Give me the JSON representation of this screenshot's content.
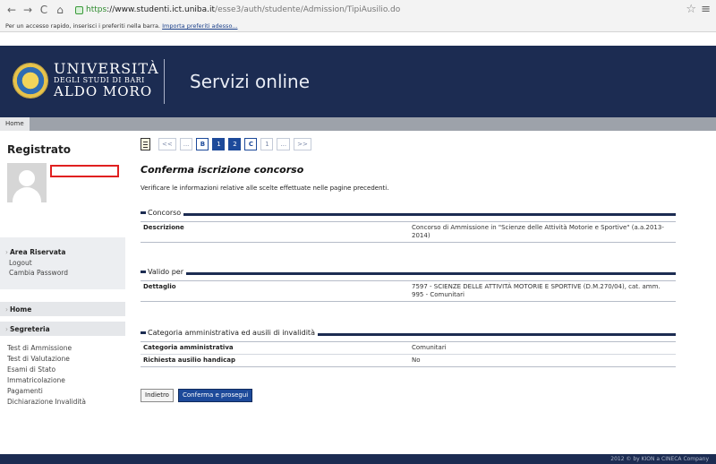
{
  "browser": {
    "url_https": "https",
    "url_host": "://www.studenti.ict.uniba.it",
    "url_path": "/esse3/auth/studente/Admission/TipiAusilio.do",
    "bookmarks_text": "Per un accesso rapido, inserisci i preferiti nella barra.",
    "bookmarks_link": "Importa preferiti adesso..."
  },
  "header": {
    "uni_line1": "UNIVERSITÀ",
    "uni_line2": "DEGLI STUDI DI BARI",
    "uni_line3": "ALDO MORO",
    "services_title": "Servizi online",
    "breadcrumb_home": "Home",
    "colors": {
      "header_bg": "#1c2c52",
      "accent": "#1d4a9a"
    }
  },
  "sidebar": {
    "title": "Registrato",
    "area_riservata": "Area Riservata",
    "logout": "Logout",
    "cambia_password": "Cambia Password",
    "home": "Home",
    "segreteria": "Segreteria",
    "links": [
      "Test di Ammissione",
      "Test di Valutazione",
      "Esami di Stato",
      "Immatricolazione",
      "Pagamenti",
      "Dichiarazione Invalidità"
    ]
  },
  "pager": {
    "prev": "<<",
    "ellipsis1": "...",
    "b": "B",
    "p1": "1",
    "p2": "2",
    "c": "C",
    "p1b": "1",
    "ellipsis2": "...",
    "next": ">>"
  },
  "main": {
    "title": "Conferma iscrizione concorso",
    "intro": "Verificare le informazioni relative alle scelte effettuate nelle pagine precedenti.",
    "concorso": {
      "heading": "Concorso",
      "label": "Descrizione",
      "value": "Concorso di Ammissione in \"Scienze delle Attività Motorie e Sportive\" (a.a.2013-2014)"
    },
    "valido": {
      "heading": "Valido per",
      "label": "Dettaglio",
      "value": "7597 - SCIENZE DELLE ATTIVITÀ MOTORIE E SPORTIVE (D.M.270/04), cat. amm. 995 - Comunitari"
    },
    "categoria": {
      "heading": "Categoria amministrativa ed ausili di invalidità",
      "label1": "Categoria amministrativa",
      "value1": "Comunitari",
      "label2": "Richiesta ausilio handicap",
      "value2": "No"
    },
    "back_button": "Indietro",
    "confirm_button": "Conferma e prosegui"
  },
  "footer": {
    "text": "2012 © by KION a CINECA Company"
  }
}
